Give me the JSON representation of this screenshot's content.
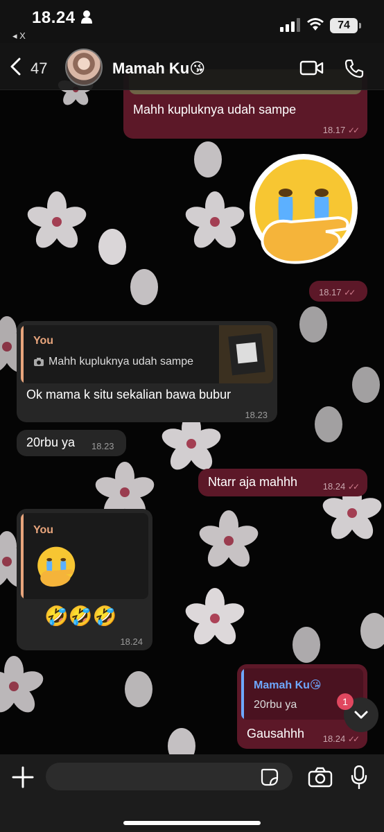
{
  "status_bar": {
    "time": "18.24",
    "back_app": "◂ X",
    "battery": "74"
  },
  "header": {
    "unread_count": "47",
    "contact_name": "Mamah Ku😘"
  },
  "messages": [
    {
      "text": "Mahh kupluknya udah sampe",
      "time": "18.17"
    },
    {
      "time": "18.17"
    },
    {
      "quote_author": "You",
      "quote_text": "Mahh kupluknya udah sampe",
      "text": "Ok mama k situ sekalian bawa bubur",
      "time": "18.23"
    },
    {
      "text": "20rbu ya",
      "time": "18.23"
    },
    {
      "text": "Ntarr aja mahhh",
      "time": "18.24"
    },
    {
      "quote_author": "You",
      "text": "🤣🤣🤣",
      "time": "18.24"
    },
    {
      "quote_author": "Mamah Ku😘",
      "quote_text": "20rbu ya",
      "text": "Gausahhh",
      "time": "18.24"
    }
  ],
  "scroll_badge": "1",
  "input": {
    "placeholder": ""
  },
  "colors": {
    "outgoing_bubble": "#5c1828",
    "incoming_bubble": "#262626",
    "badge": "#e0475f",
    "quote_you": "#e8a57c",
    "quote_contact": "#6ea8ff"
  }
}
